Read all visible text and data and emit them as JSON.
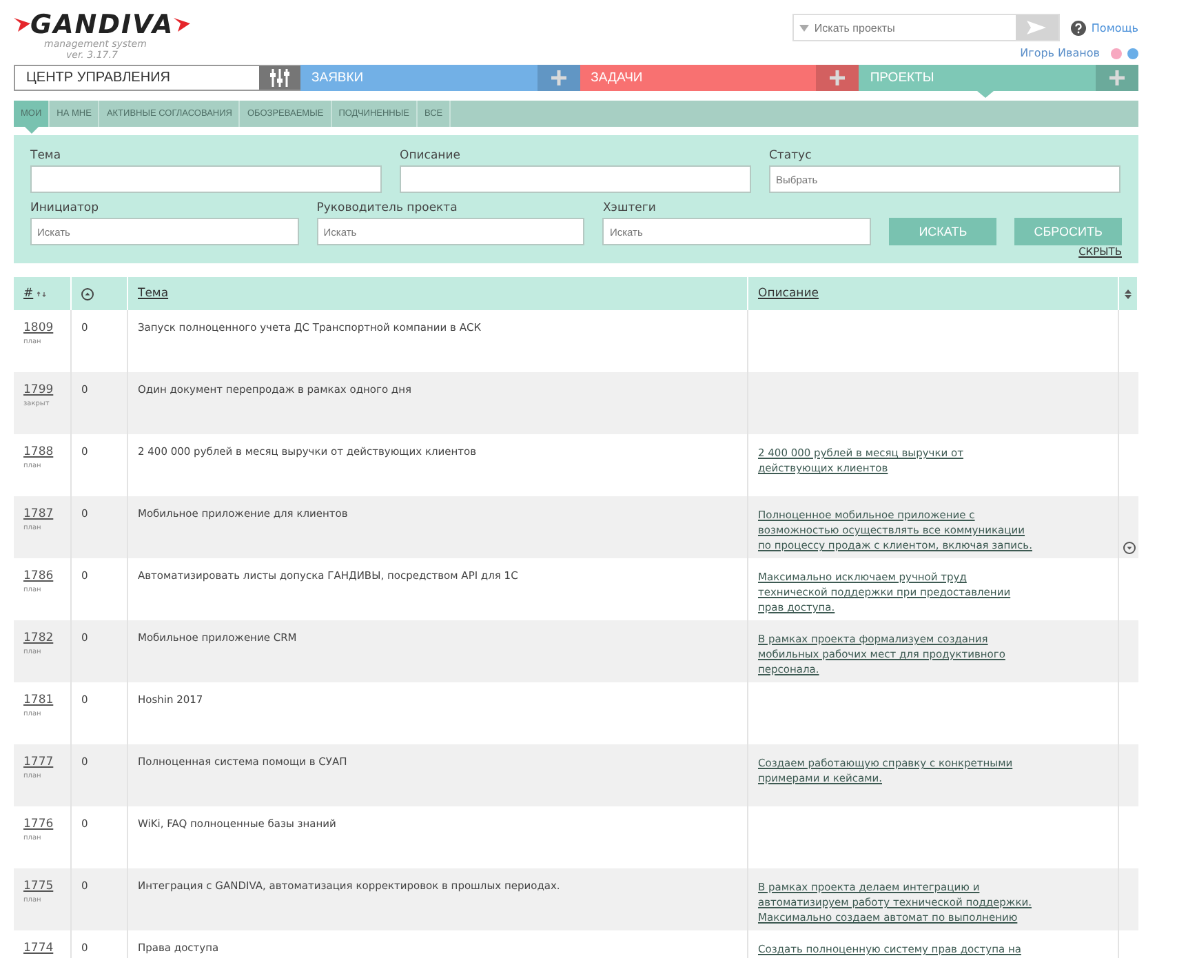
{
  "logo": {
    "name": "GANDIVA",
    "subtitle": "management system",
    "version": "ver. 3.17.7"
  },
  "search": {
    "placeholder": "Искать проекты"
  },
  "help": {
    "label": "Помощь"
  },
  "user": {
    "name": "Игорь Иванов",
    "dots": [
      {
        "color": "#f7a8c0"
      },
      {
        "color": "#6aaee8"
      }
    ]
  },
  "control_center": {
    "label": "ЦЕНТР УПРАВЛЕНИЯ"
  },
  "sections": [
    {
      "label": "ЗАЯВКИ",
      "color": "#72b0e6",
      "selected": false
    },
    {
      "label": "ЗАДАЧИ",
      "color": "#f87171",
      "selected": false
    },
    {
      "label": "ПРОЕКТЫ",
      "color": "#7ec8b6",
      "selected": true
    }
  ],
  "subtabs": [
    {
      "label": "МОИ",
      "selected": true
    },
    {
      "label": "НА МНЕ",
      "selected": false
    },
    {
      "label": "АКТИВНЫЕ СОГЛАСОВАНИЯ",
      "selected": false
    },
    {
      "label": "ОБОЗРЕВАЕМЫЕ",
      "selected": false
    },
    {
      "label": "ПОДЧИНЕННЫЕ",
      "selected": false
    },
    {
      "label": "ВСЕ",
      "selected": false
    }
  ],
  "filters": {
    "row_1": [
      {
        "label": "Тема"
      },
      {
        "label": "Описание"
      },
      {
        "label": "Статус",
        "placeholder": "Выбрать"
      }
    ],
    "row_2": [
      {
        "label": "Инициатор",
        "placeholder": "Искать"
      },
      {
        "label": "Руководитель проекта",
        "placeholder": "Искать"
      },
      {
        "label": "Хэштеги",
        "placeholder": "Искать"
      }
    ],
    "search_button": "ИСКАТЬ",
    "reset_button": "СБРОСИТЬ",
    "hide_link": "СКРЫТЬ"
  },
  "table": {
    "columns": [
      "#",
      "Тема",
      "Описание"
    ],
    "rows": [
      {
        "id": "1809",
        "status": "план",
        "count": "0",
        "topic": "Запуск полноценного учета ДС Транспортной компании в АСК",
        "description": ""
      },
      {
        "id": "1799",
        "status": "закрыт",
        "count": "0",
        "topic": "Один документ перепродаж в рамках одного дня",
        "description": ""
      },
      {
        "id": "1788",
        "status": "план",
        "count": "0",
        "topic": "2 400 000 рублей в месяц выручки от действующих клиентов",
        "description": "2 400 000 рублей в месяц выручки от действующих клиентов"
      },
      {
        "id": "1787",
        "status": "план",
        "count": "0",
        "topic": "Мобильное приложение для клиентов",
        "description": "Полноценное мобильное приложение с возможностью осуществлять все коммуникации по процессу продаж с клиентом, включая запись.",
        "expand": true
      },
      {
        "id": "1786",
        "status": "план",
        "count": "0",
        "topic": "Автоматизировать листы допуска ГАНДИВЫ, посредством API для 1С",
        "description": "Максимально исключаем ручной труд технической поддержки при предоставлении прав доступа."
      },
      {
        "id": "1782",
        "status": "план",
        "count": "0",
        "topic": "Мобильное приложение CRM",
        "description": "В рамках проекта формализуем создания мобильных рабочих мест для продуктивного персонала."
      },
      {
        "id": "1781",
        "status": "план",
        "count": "0",
        "topic": "Hoshin 2017",
        "description": ""
      },
      {
        "id": "1777",
        "status": "план",
        "count": "0",
        "topic": "Полноценная система помощи в СУАП",
        "description": "Создаем работающую справку с конкретными примерами и кейсами."
      },
      {
        "id": "1776",
        "status": "план",
        "count": "0",
        "topic": "WiKi, FAQ полноценные базы знаний",
        "description": ""
      },
      {
        "id": "1775",
        "status": "план",
        "count": "0",
        "topic": "Интеграция с GANDIVA, автоматизация корректировок в прошлых периодах.",
        "description": "В рамках проекта делаем интеграцию и автоматизируем работу технической поддержки. Максимально создаем автомат по выполнению"
      },
      {
        "id": "1774",
        "count": "0",
        "topic": "Права доступа",
        "description": "Создать полноценную систему прав доступа на"
      }
    ]
  }
}
